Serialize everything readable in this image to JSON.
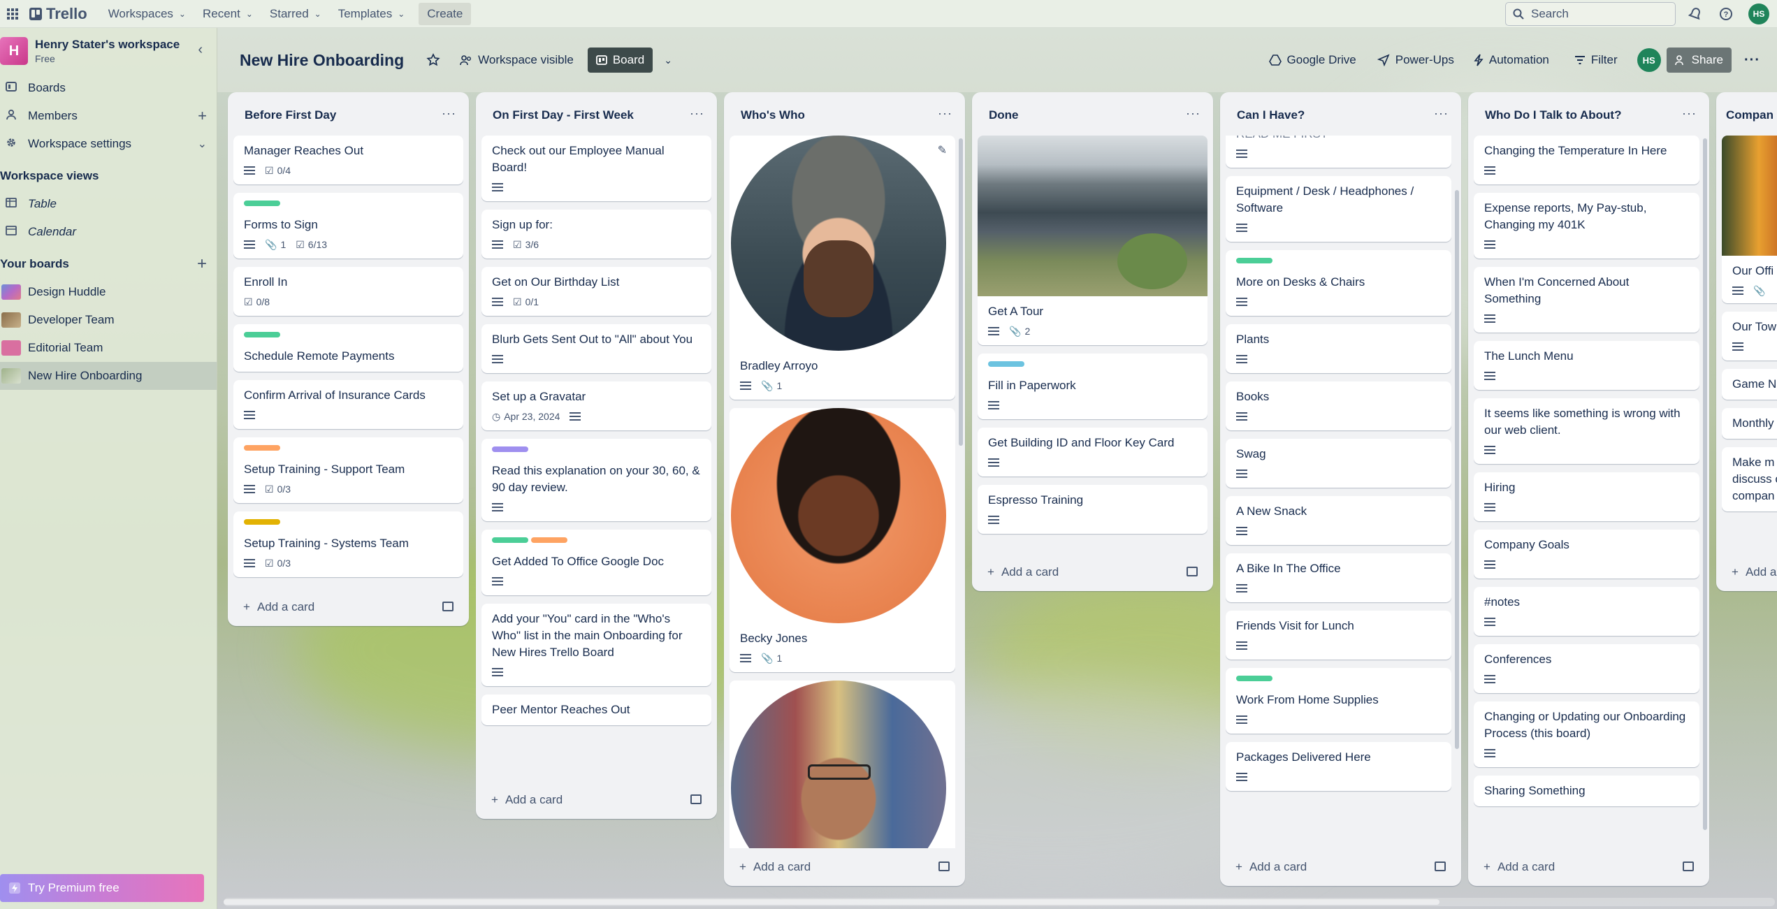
{
  "topnav": {
    "logo": "Trello",
    "menus": [
      "Workspaces",
      "Recent",
      "Starred",
      "Templates"
    ],
    "create_label": "Create",
    "search_placeholder": "Search",
    "user_initials": "HS"
  },
  "sidebar": {
    "workspace_initial": "H",
    "workspace_name": "Henry Stater's workspace",
    "workspace_plan": "Free",
    "items": [
      {
        "label": "Boards",
        "icon": "trello-board-icon"
      },
      {
        "label": "Members",
        "icon": "person-icon"
      },
      {
        "label": "Workspace settings",
        "icon": "gear-icon"
      }
    ],
    "views_heading": "Workspace views",
    "views": [
      {
        "label": "Table",
        "icon": "table-icon"
      },
      {
        "label": "Calendar",
        "icon": "calendar-icon"
      }
    ],
    "boards_heading": "Your boards",
    "boards": [
      {
        "label": "Design Huddle",
        "color": "#8b79c9"
      },
      {
        "label": "Developer Team",
        "color": "#8a7a5c"
      },
      {
        "label": "Editorial Team",
        "color": "#d96fa0"
      },
      {
        "label": "New Hire Onboarding",
        "color": "#a6b494"
      }
    ],
    "premium_label": "Try Premium free"
  },
  "board": {
    "title": "New Hire Onboarding",
    "visibility": "Workspace visible",
    "view_label": "Board",
    "google_drive": "Google Drive",
    "power_ups": "Power-Ups",
    "automation": "Automation",
    "filter": "Filter",
    "member_initials": "HS",
    "share_label": "Share"
  },
  "add_card_label": "Add a card",
  "lists": [
    {
      "title": "Before First Day",
      "cards": [
        {
          "title": "Manager Reaches Out",
          "desc": true,
          "checklist": "0/4"
        },
        {
          "title": "Forms to Sign",
          "labels": [
            "#4bce97"
          ],
          "desc": true,
          "attachments": "1",
          "checklist": "6/13"
        },
        {
          "title": "Enroll In",
          "checklist": "0/8"
        },
        {
          "title": "Schedule Remote Payments",
          "labels": [
            "#4bce97"
          ]
        },
        {
          "title": "Confirm Arrival of Insurance Cards",
          "desc": true
        },
        {
          "title": "Setup Training - Support Team",
          "labels": [
            "#fea362"
          ],
          "desc": true,
          "checklist": "0/3"
        },
        {
          "title": "Setup Training - Systems Team",
          "labels": [
            "#e2b203"
          ],
          "desc": true,
          "checklist": "0/3"
        }
      ]
    },
    {
      "title": "On First Day - First Week",
      "cards": [
        {
          "title": "Check out our Employee Manual Board!",
          "desc": true
        },
        {
          "title": "Sign up for:",
          "desc": true,
          "checklist": "3/6"
        },
        {
          "title": "Get on Our Birthday List",
          "desc": true,
          "checklist": "0/1"
        },
        {
          "title": "Blurb Gets Sent Out to \"All\" about You",
          "desc": true
        },
        {
          "title": "Set up a Gravatar",
          "date": "Apr 23, 2024",
          "desc_after": true
        },
        {
          "title": "Read this explanation on your 30, 60, & 90 day review.",
          "labels": [
            "#9f8fef"
          ],
          "desc": true
        },
        {
          "title": "Get Added To Office Google Doc",
          "labels": [
            "#4bce97",
            "#fea362"
          ],
          "desc": true
        },
        {
          "title": "Add your \"You\" card in the \"Who's Who\" list in the main Onboarding for New Hires Trello Board",
          "desc": true
        },
        {
          "title": "Peer Mentor Reaches Out"
        }
      ]
    },
    {
      "title": "Who's Who",
      "cards": [
        {
          "title": "Bradley Arroyo",
          "desc": true,
          "attachments": "1"
        },
        {
          "title": "Becky Jones",
          "desc": true,
          "attachments": "1"
        },
        {
          "title": ""
        }
      ]
    },
    {
      "title": "Done",
      "cards": [
        {
          "title": "Get A Tour",
          "desc": true,
          "attachments": "2"
        },
        {
          "title": "Fill in Paperwork",
          "labels": [
            "#6cc3e0"
          ],
          "desc": true
        },
        {
          "title": "Get Building ID and Floor Key Card",
          "desc": true
        },
        {
          "title": "Espresso Training",
          "desc": true
        }
      ]
    },
    {
      "title": "Can I Have?",
      "cards": [
        {
          "title": "READ ME FIRST",
          "desc": true
        },
        {
          "title": "Equipment / Desk / Headphones / Software",
          "desc": true
        },
        {
          "title": "More on Desks & Chairs",
          "labels": [
            "#4bce97"
          ],
          "desc": true
        },
        {
          "title": "Plants",
          "desc": true
        },
        {
          "title": "Books",
          "desc": true
        },
        {
          "title": "Swag",
          "desc": true
        },
        {
          "title": "A New Snack",
          "desc": true
        },
        {
          "title": "A Bike In The Office",
          "desc": true
        },
        {
          "title": "Friends Visit for Lunch",
          "desc": true
        },
        {
          "title": "Work From Home Supplies",
          "labels": [
            "#4bce97"
          ],
          "desc": true
        },
        {
          "title": "Packages Delivered Here",
          "desc": true
        }
      ]
    },
    {
      "title": "Who Do I Talk to About?",
      "cards": [
        {
          "title": "Changing the Temperature In Here",
          "desc": true
        },
        {
          "title": "Expense reports, My Pay-stub, Changing my 401K",
          "desc": true
        },
        {
          "title": "When I'm Concerned About Something",
          "desc": true
        },
        {
          "title": "The Lunch Menu",
          "desc": true
        },
        {
          "title": "It seems like something is wrong with our web client.",
          "desc": true
        },
        {
          "title": "Hiring",
          "desc": true
        },
        {
          "title": "Company Goals",
          "desc": true
        },
        {
          "title": "#notes",
          "desc": true
        },
        {
          "title": "Conferences",
          "desc": true
        },
        {
          "title": "Changing or Updating our Onboarding Process (this board)",
          "desc": true
        },
        {
          "title": "Sharing Something"
        }
      ]
    },
    {
      "title": "Compan",
      "cards": [
        {
          "title": "Our Offi",
          "desc": true,
          "attachments": ""
        },
        {
          "title": "Our Tow",
          "desc": true
        },
        {
          "title": "Game N"
        },
        {
          "title": "Monthly"
        },
        {
          "title": "Make m discuss c compan"
        }
      ]
    }
  ]
}
